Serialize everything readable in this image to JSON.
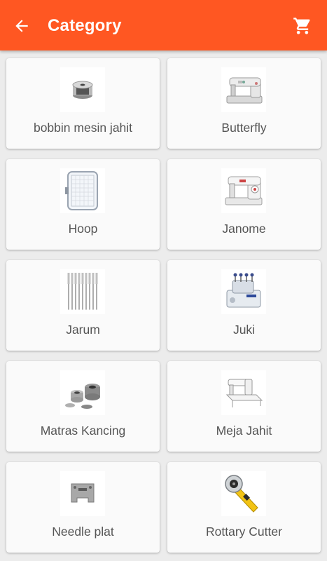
{
  "app": {
    "title": "Category",
    "back_icon": "arrow-left-icon",
    "cart_icon": "shopping-cart-icon",
    "accent_color": "#ff5722"
  },
  "categories": [
    {
      "label": "bobbin mesin jahit",
      "icon": "bobbin-image"
    },
    {
      "label": "Butterfly",
      "icon": "sewing-machine-image"
    },
    {
      "label": "Hoop",
      "icon": "embroidery-hoop-image"
    },
    {
      "label": "Janome",
      "icon": "sewing-machine-image"
    },
    {
      "label": "Jarum",
      "icon": "needles-image"
    },
    {
      "label": "Juki",
      "icon": "overlock-machine-image"
    },
    {
      "label": "Matras Kancing",
      "icon": "button-dies-image"
    },
    {
      "label": "Meja Jahit",
      "icon": "sewing-table-image"
    },
    {
      "label": "Needle plat",
      "icon": "needle-plate-image"
    },
    {
      "label": "Rottary Cutter",
      "icon": "rotary-cutter-image"
    }
  ]
}
